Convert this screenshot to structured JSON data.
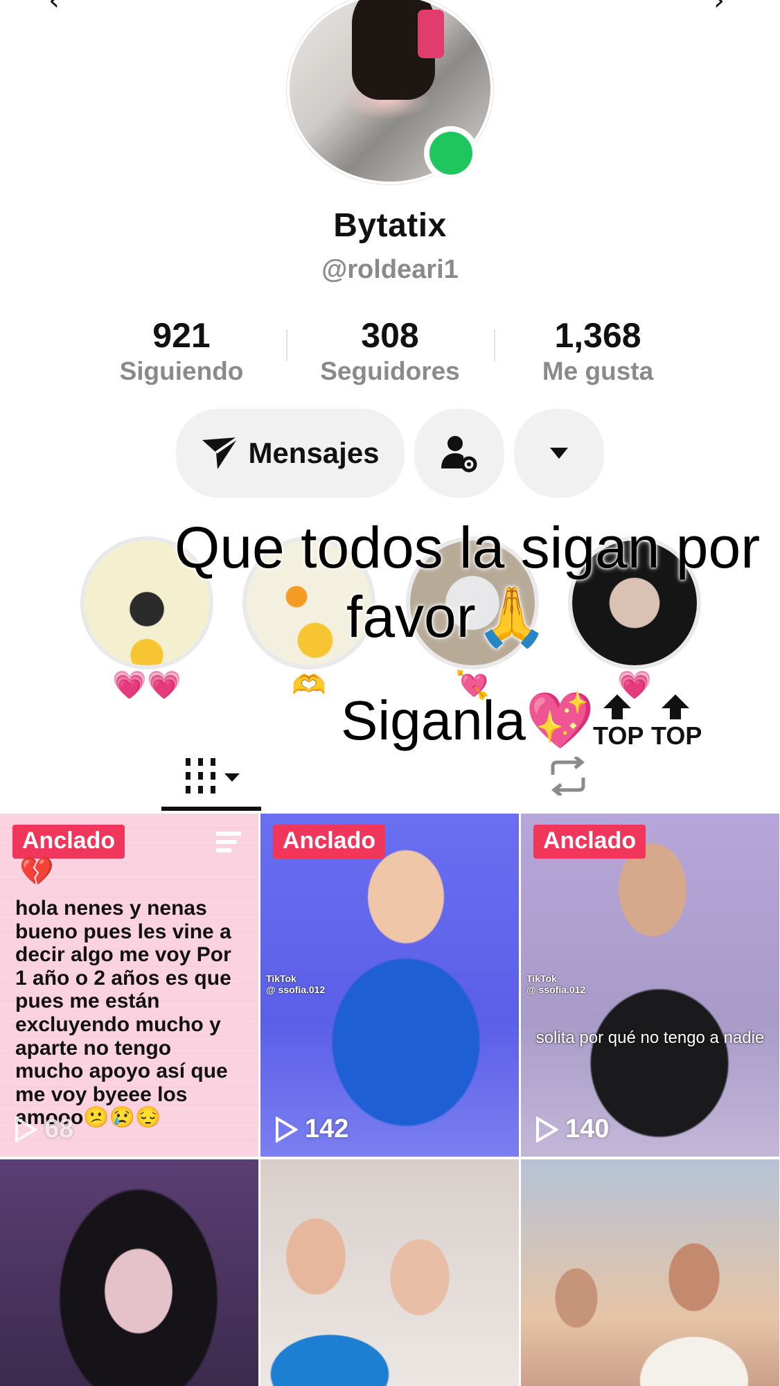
{
  "profile": {
    "display_name": "Bytatix",
    "handle": "@roldeari1"
  },
  "stats": [
    {
      "value": "921",
      "label": "Siguiendo"
    },
    {
      "value": "308",
      "label": "Seguidores"
    },
    {
      "value": "1,368",
      "label": "Me gusta"
    }
  ],
  "actions": {
    "messages_label": "Mensajes"
  },
  "highlights": [
    {
      "emoji": "💗💗"
    },
    {
      "emoji": "🫶"
    },
    {
      "emoji": "💘"
    },
    {
      "emoji": "💗"
    }
  ],
  "overlay": {
    "line1": "Que todos la sigan por",
    "line2": "favor🙏",
    "line3": "Siganla💖",
    "top_badge": "TOP"
  },
  "videos": [
    {
      "pinned_label": "Anclado",
      "views": "68",
      "text": "hola nenes y nenas bueno pues les vine a decir algo me voy Por 1 año o 2 años es que pues me están excluyendo mucho y aparte no tengo mucho apoyo así que me voy byeee los amooo😕😢😔"
    },
    {
      "pinned_label": "Anclado",
      "views": "142",
      "watermark": "TikTok\n@ ssofia.012"
    },
    {
      "pinned_label": "Anclado",
      "views": "140",
      "watermark": "TikTok\n@ ssofia.012",
      "caption": "solita por qué no tengo a nadie"
    },
    {},
    {},
    {}
  ],
  "colors": {
    "accent": "#f0365a",
    "online": "#1fc65e",
    "muted_text": "#8a8a8a",
    "pill_bg": "#f1f1f1"
  }
}
